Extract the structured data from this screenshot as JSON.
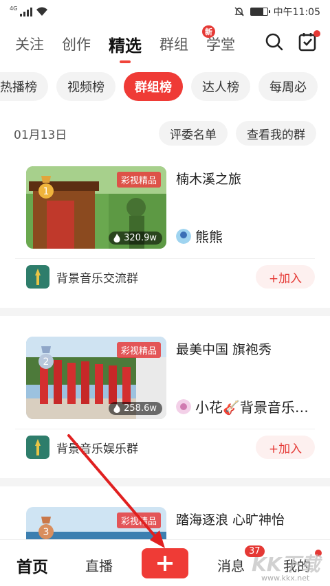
{
  "status_bar": {
    "network": "4G",
    "time": "中午11:05"
  },
  "top_nav": {
    "tabs": [
      {
        "label": "关注"
      },
      {
        "label": "创作"
      },
      {
        "label": "精选",
        "active": true
      },
      {
        "label": "群组"
      },
      {
        "label": "学堂",
        "badge": "新"
      }
    ]
  },
  "chips": [
    {
      "label": "热播榜"
    },
    {
      "label": "视频榜"
    },
    {
      "label": "群组榜",
      "active": true
    },
    {
      "label": "达人榜"
    },
    {
      "label": "每周必"
    }
  ],
  "date_row": {
    "date": "01月13日",
    "judges_label": "评委名单",
    "my_group_label": "查看我的群"
  },
  "cards": [
    {
      "tag": "彩视精品",
      "views": "320.9w",
      "title": "楠木溪之旅",
      "author": "熊熊",
      "group": "背景音乐交流群",
      "join": "+加入",
      "rank": "1"
    },
    {
      "tag": "彩视精品",
      "views": "258.6w",
      "title": "最美中国  旗袍秀",
      "author": "小花🎸背景音乐…",
      "group": "背景音乐娱乐群",
      "join": "+加入",
      "rank": "2"
    },
    {
      "tag": "彩视精品",
      "title": "踏海逐浪  心旷神怡",
      "rank": "3"
    }
  ],
  "bottom_nav": {
    "home": "首页",
    "live": "直播",
    "messages": "消息",
    "messages_badge": "37",
    "me": "我的"
  },
  "watermark": {
    "logo": "KK下载",
    "url": "www.kkx.net"
  },
  "colors": {
    "accent": "#ef3b36"
  }
}
